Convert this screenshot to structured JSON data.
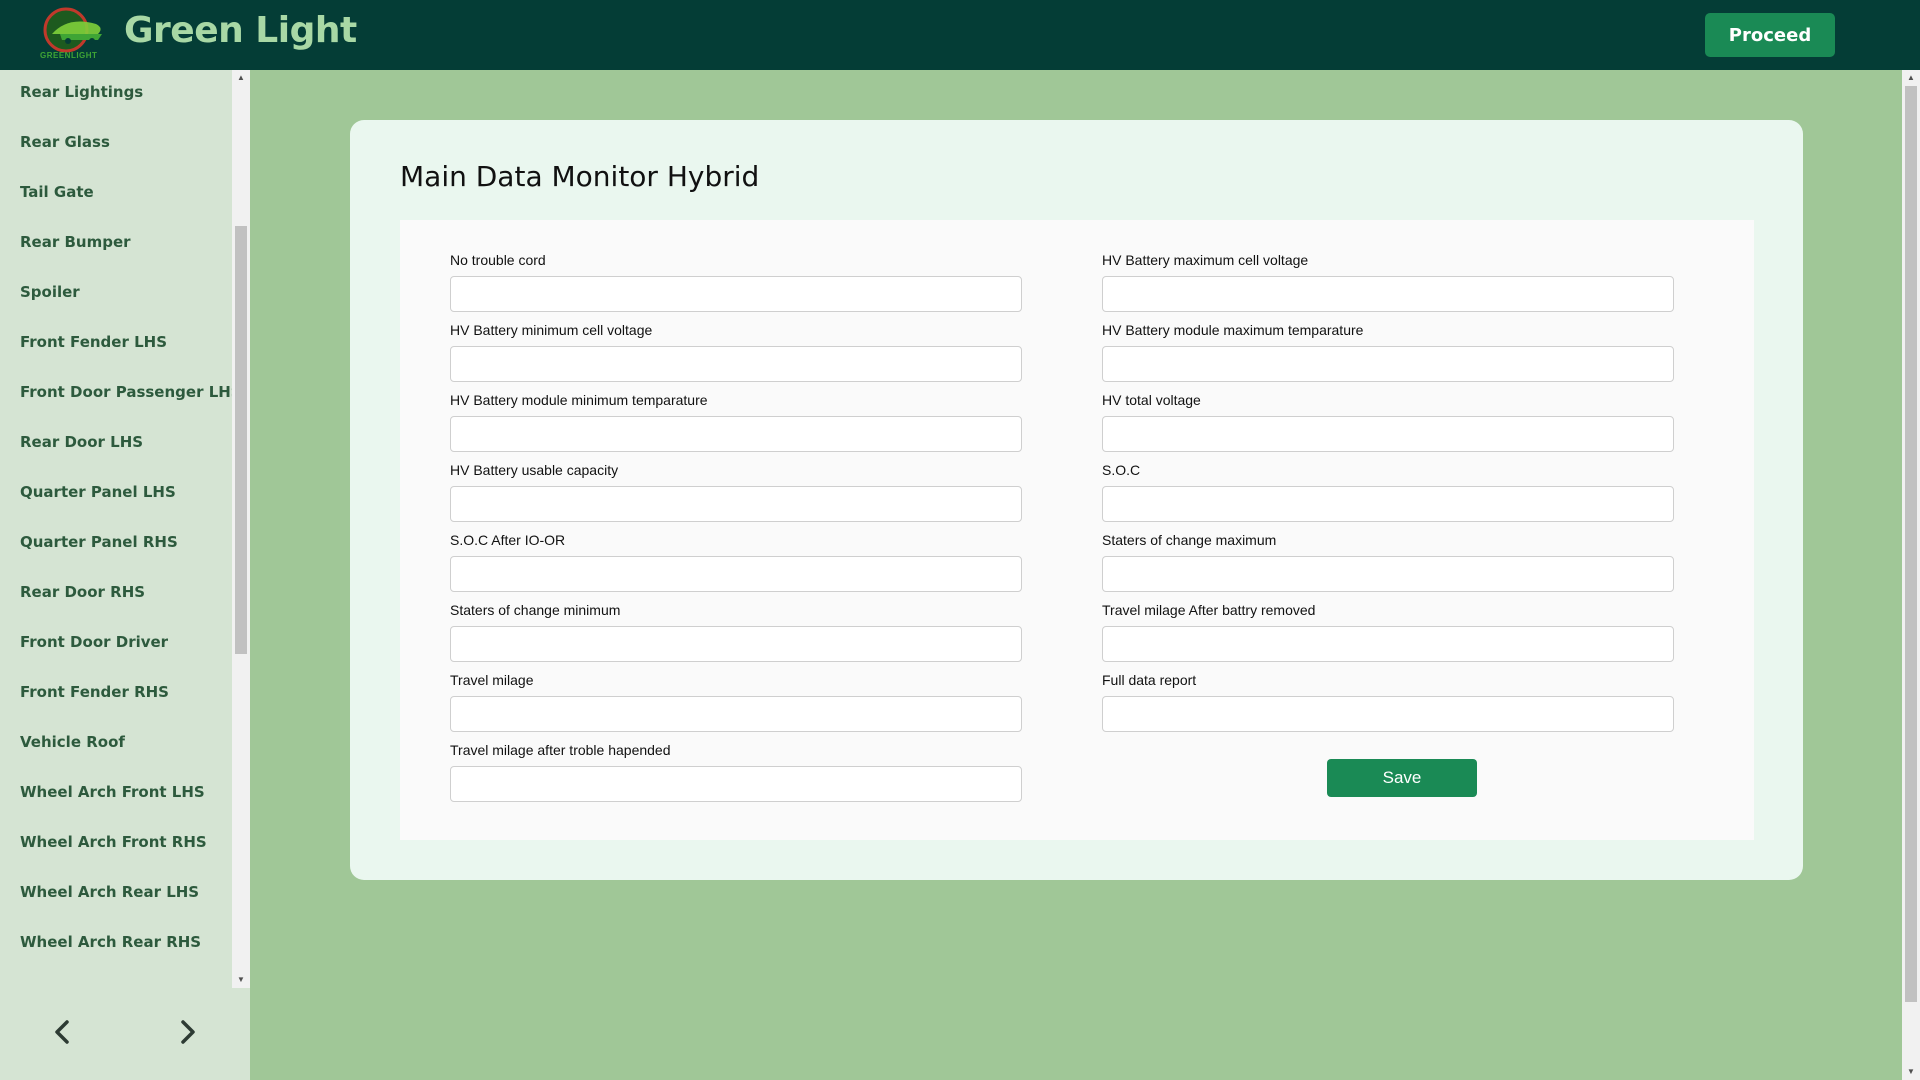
{
  "header": {
    "brand_title": "Green Light",
    "logo_text": "GREENLIGHT",
    "proceed_label": "Proceed"
  },
  "sidebar": {
    "items": [
      {
        "label": "Rear Lightings"
      },
      {
        "label": "Rear Glass"
      },
      {
        "label": "Tail Gate"
      },
      {
        "label": "Rear Bumper"
      },
      {
        "label": "Spoiler"
      },
      {
        "label": "Front Fender LHS"
      },
      {
        "label": "Front Door Passenger LHS"
      },
      {
        "label": "Rear Door LHS"
      },
      {
        "label": "Quarter Panel LHS"
      },
      {
        "label": "Quarter Panel RHS"
      },
      {
        "label": "Rear Door RHS"
      },
      {
        "label": "Front Door Driver"
      },
      {
        "label": "Front Fender RHS"
      },
      {
        "label": "Vehicle Roof"
      },
      {
        "label": "Wheel Arch Front LHS"
      },
      {
        "label": "Wheel Arch Front RHS"
      },
      {
        "label": "Wheel Arch Rear LHS"
      },
      {
        "label": "Wheel Arch Rear RHS"
      }
    ],
    "prev_icon": "chevron-left-icon",
    "next_icon": "chevron-right-icon"
  },
  "main": {
    "title": "Main Data Monitor Hybrid",
    "fields": [
      {
        "label": "No trouble cord",
        "value": ""
      },
      {
        "label": "HV Battery maximum cell voltage",
        "value": ""
      },
      {
        "label": "HV Battery minimum cell voltage",
        "value": ""
      },
      {
        "label": "HV Battery module maximum temparature",
        "value": ""
      },
      {
        "label": "HV Battery module minimum temparature",
        "value": ""
      },
      {
        "label": "HV total voltage",
        "value": ""
      },
      {
        "label": "HV Battery usable capacity",
        "value": ""
      },
      {
        "label": "S.O.C",
        "value": ""
      },
      {
        "label": "S.O.C After IO-OR",
        "value": ""
      },
      {
        "label": "Staters of change maximum",
        "value": ""
      },
      {
        "label": "Staters of change minimum",
        "value": ""
      },
      {
        "label": "Travel milage After battry removed",
        "value": ""
      },
      {
        "label": "Travel milage",
        "value": ""
      },
      {
        "label": "Full data report",
        "value": ""
      },
      {
        "label": "Travel milage after troble hapended",
        "value": ""
      }
    ],
    "save_label": "Save"
  },
  "colors": {
    "header_bg": "#043d36",
    "brand_text": "#a8d8a5",
    "accent_green": "#1a8a55",
    "page_bg": "#a0c797",
    "sidebar_bg": "#d5e4d3",
    "card_bg": "#eaf7ef"
  }
}
